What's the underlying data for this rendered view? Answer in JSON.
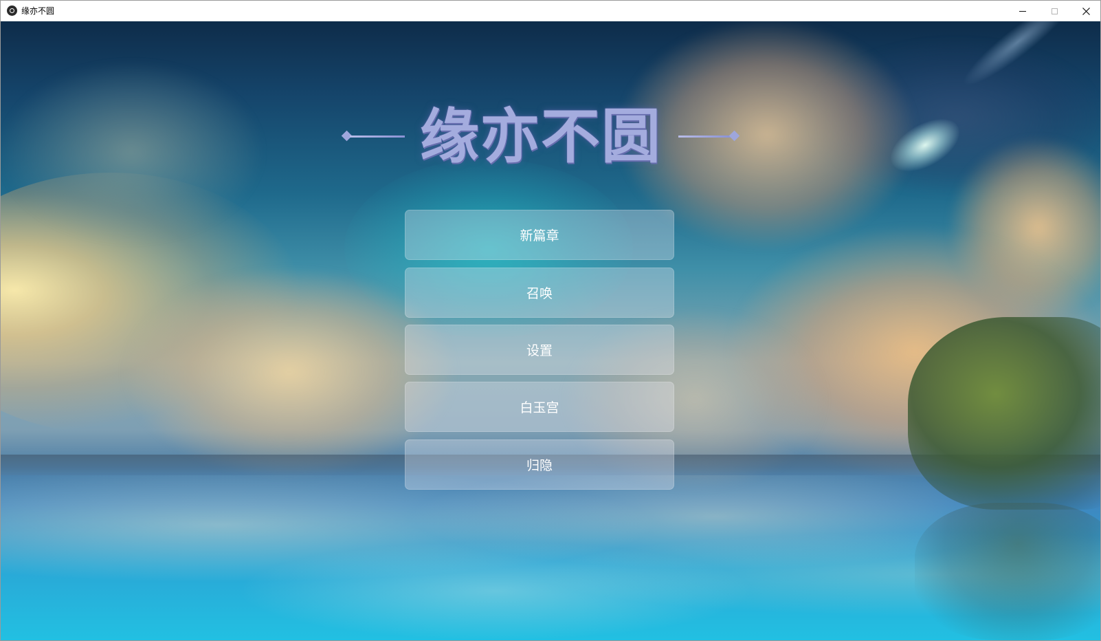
{
  "window": {
    "title": "缘亦不圆",
    "icon": "app-circle-icon",
    "controls": [
      "minimize-icon",
      "maximize-icon",
      "close-icon"
    ]
  },
  "game": {
    "title": "缘亦不圆"
  },
  "menu": {
    "items": [
      {
        "label": "新篇章"
      },
      {
        "label": "召唤"
      },
      {
        "label": "设置"
      },
      {
        "label": "白玉宫"
      },
      {
        "label": "归隐"
      }
    ]
  },
  "colors": {
    "title_color": "#a4acde",
    "button_bg": "rgba(235,235,245,0.32)",
    "button_text": "#ffffff"
  }
}
